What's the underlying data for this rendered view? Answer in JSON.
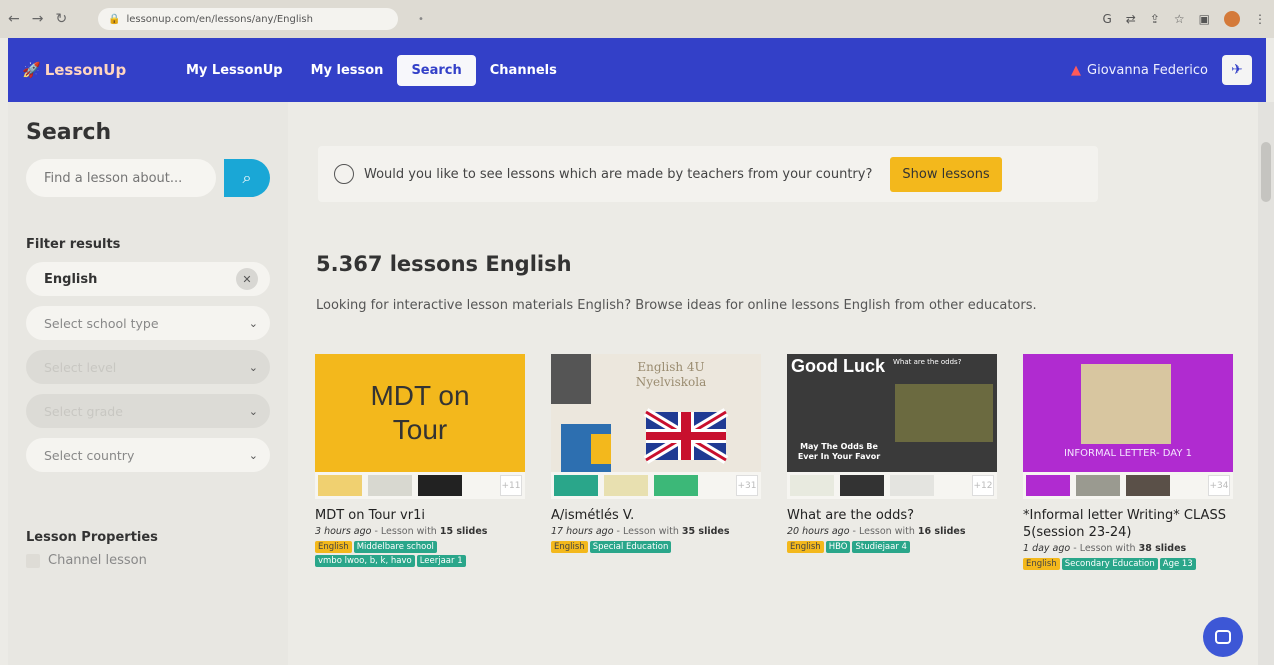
{
  "browser": {
    "url": "lessonup.com/en/lessons/any/English",
    "tab_indicator": "•"
  },
  "nav": {
    "logo": "LessonUp",
    "links": [
      "My LessonUp",
      "My lesson",
      "Search",
      "Channels"
    ],
    "active": "Search",
    "user": "Giovanna Federico"
  },
  "sidebar": {
    "title": "Search",
    "search_placeholder": "Find a lesson about...",
    "filter_title": "Filter results",
    "selected_filter": "English",
    "school_type": "Select school type",
    "level": "Select level",
    "grade": "Select grade",
    "country": "Select country",
    "properties_title": "Lesson Properties",
    "channel_lesson": "Channel lesson"
  },
  "main": {
    "banner_text": "Would you like to see lessons which are made by teachers from your country?",
    "banner_button": "Show lessons",
    "results_title": "5.367 lessons English",
    "results_sub": "Looking for interactive lesson materials English? Browse ideas for online lessons English from other educators.",
    "cards": [
      {
        "thumb_text": "MDT on Tour",
        "more": "+11",
        "title": "MDT on Tour vr1i",
        "time": "3 hours ago",
        "meta_mid": " - Lesson with ",
        "slides": "15 slides",
        "tags": [
          "English",
          "Middelbare school",
          "vmbo lwoo, b, k, havo",
          "Leerjaar 1"
        ]
      },
      {
        "thumb_text": "English 4U Nyelviskola",
        "more": "+31",
        "title": "A/ismétlés V.",
        "time": "17 hours ago",
        "meta_mid": " - Lesson with ",
        "slides": "35 slides",
        "tags": [
          "English",
          "Special Education"
        ]
      },
      {
        "thumb_text": "Good Luck",
        "thumb_text2": "What are the odds?",
        "thumb_text3": "May The Odds Be Ever In Your Favor",
        "more": "+12",
        "title": "What are the odds?",
        "time": "20 hours ago",
        "meta_mid": " - Lesson with ",
        "slides": "16 slides",
        "tags": [
          "English",
          "HBO",
          "Studiejaar 4"
        ]
      },
      {
        "thumb_text": "INFORMAL LETTER- DAY 1",
        "more": "+34",
        "title": "*Informal letter Writing* CLASS 5(session 23-24)",
        "time": "1 day ago",
        "meta_mid": " - Lesson with ",
        "slides": "38 slides",
        "tags": [
          "English",
          "Secondary Education",
          "Age 13"
        ]
      }
    ]
  },
  "colors": {
    "nav_bg": "#3340c8",
    "accent_yellow": "#f3b81c",
    "search_button": "#1aa7d6",
    "tag_green": "#2aa68a"
  }
}
